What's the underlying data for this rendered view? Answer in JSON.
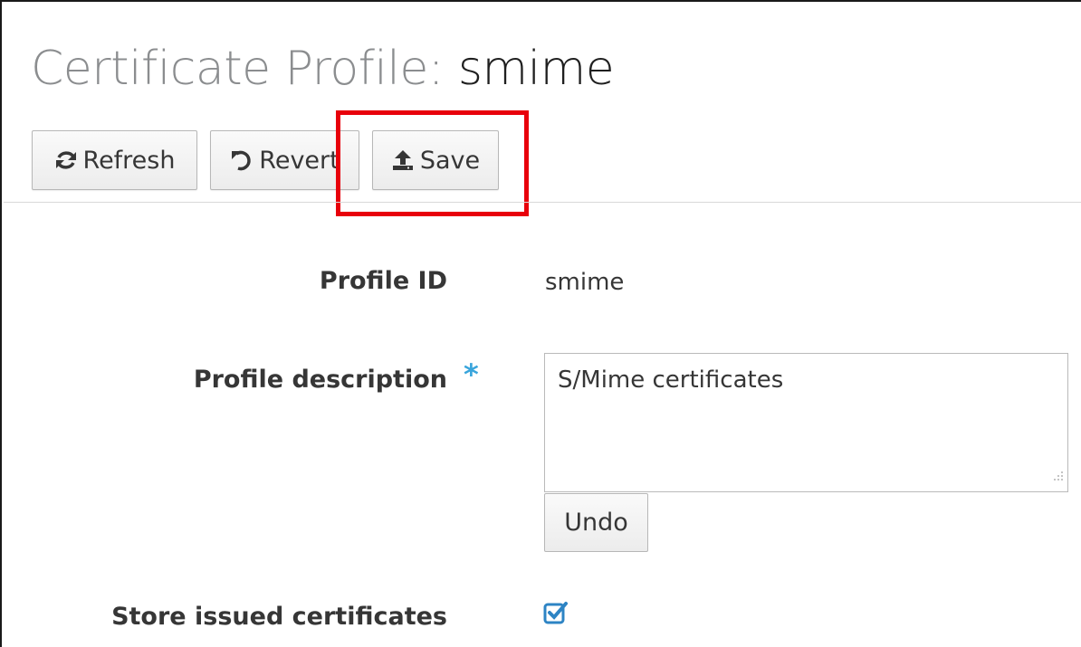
{
  "header": {
    "title_prefix": "Certificate Profile:",
    "title_name": "smime"
  },
  "toolbar": {
    "refresh_label": "Refresh",
    "revert_label": "Revert",
    "save_label": "Save",
    "refresh_icon": "refresh-icon",
    "revert_icon": "undo-icon",
    "save_icon": "upload-icon",
    "highlight_color": "#e8000b"
  },
  "form": {
    "profile_id": {
      "label": "Profile ID",
      "value": "smime"
    },
    "profile_description": {
      "label": "Profile description",
      "required_marker": "*",
      "value": "S/Mime certificates",
      "undo_label": "Undo"
    },
    "store_issued": {
      "label": "Store issued certificates",
      "checked": true
    }
  },
  "colors": {
    "accent": "#39a5dc",
    "title_muted": "#8b8d8f"
  }
}
